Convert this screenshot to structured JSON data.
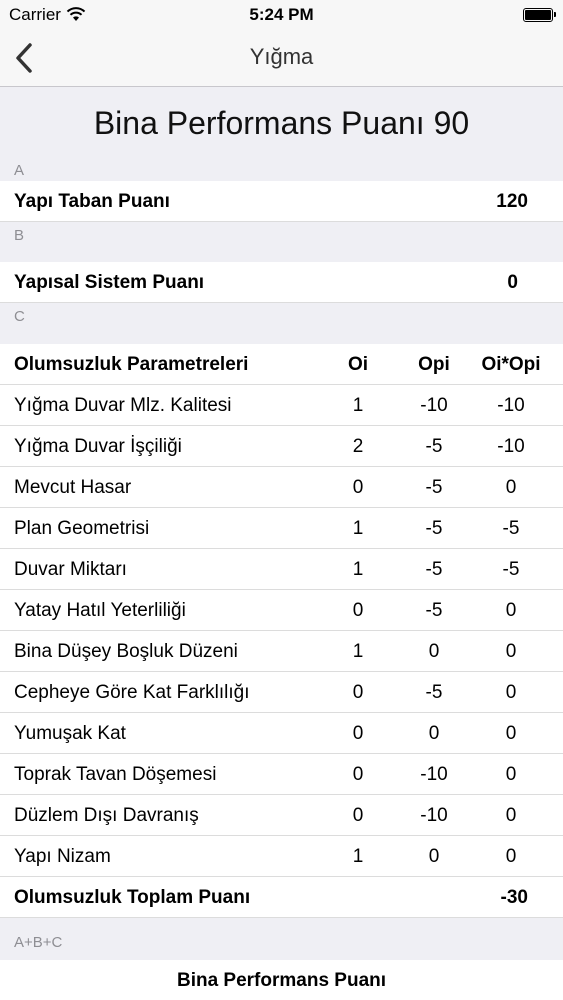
{
  "status": {
    "carrier": "Carrier",
    "time": "5:24 PM"
  },
  "nav": {
    "title": "Yığma"
  },
  "score": {
    "title": "Bina Performans Puanı 90"
  },
  "sectionA": {
    "header": "A",
    "label": "Yapı Taban Puanı",
    "value": "120"
  },
  "sectionB": {
    "header": "B",
    "label": "Yapısal Sistem Puanı",
    "value": "0"
  },
  "sectionC": {
    "header": "C",
    "columns": {
      "name": "Olumsuzluk Parametreleri",
      "oi": "Oi",
      "opi": "Opi",
      "product": "Oi*Opi"
    },
    "rows": [
      {
        "name": "Yığma Duvar Mlz. Kalitesi",
        "oi": "1",
        "opi": "-10",
        "product": "-10"
      },
      {
        "name": "Yığma Duvar İşçiliği",
        "oi": "2",
        "opi": "-5",
        "product": "-10"
      },
      {
        "name": "Mevcut Hasar",
        "oi": "0",
        "opi": "-5",
        "product": "0"
      },
      {
        "name": "Plan Geometrisi",
        "oi": "1",
        "opi": "-5",
        "product": "-5"
      },
      {
        "name": "Duvar Miktarı",
        "oi": "1",
        "opi": "-5",
        "product": "-5"
      },
      {
        "name": "Yatay Hatıl Yeterliliği",
        "oi": "0",
        "opi": "-5",
        "product": "0"
      },
      {
        "name": "Bina Düşey Boşluk Düzeni",
        "oi": "1",
        "opi": "0",
        "product": "0"
      },
      {
        "name": "Cepheye Göre Kat Farklılığı",
        "oi": "0",
        "opi": "-5",
        "product": "0"
      },
      {
        "name": "Yumuşak Kat",
        "oi": "0",
        "opi": "0",
        "product": "0"
      },
      {
        "name": "Toprak Tavan Döşemesi",
        "oi": "0",
        "opi": "-10",
        "product": "0"
      },
      {
        "name": "Düzlem Dışı Davranış",
        "oi": "0",
        "opi": "-10",
        "product": "0"
      },
      {
        "name": "Yapı Nizam",
        "oi": "1",
        "opi": "0",
        "product": "0"
      }
    ],
    "total_label": "Olumsuzluk Toplam Puanı",
    "total_value": "-30"
  },
  "sectionABC": {
    "header": "A+B+C",
    "label": "Bina Performans Puanı"
  }
}
